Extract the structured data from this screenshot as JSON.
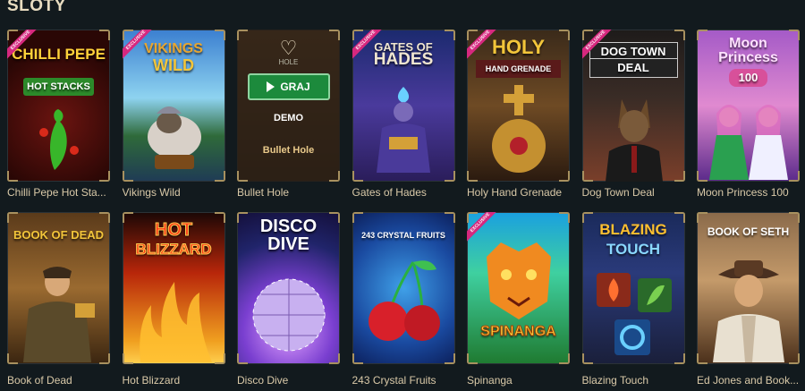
{
  "section": {
    "title": "SLOTY"
  },
  "badge": {
    "exclusive": "EXCLUSIVE"
  },
  "hover": {
    "play_label": "GRAJ",
    "demo_label": "DEMO",
    "art_label": "HOLE"
  },
  "games": [
    {
      "name": "Chilli Pepe Hot Sta...",
      "art_title": "CHILLI PEPE",
      "art_sub": "HOT STACKS",
      "exclusive": true
    },
    {
      "name": "Vikings Wild",
      "art_title": "VIKINGS",
      "art_sub": "WILD",
      "exclusive": true
    },
    {
      "name": "Bullet Hole",
      "art_title": "",
      "art_sub": "",
      "exclusive": false
    },
    {
      "name": "Gates of Hades",
      "art_title": "GATES OF",
      "art_sub": "HADES",
      "exclusive": true
    },
    {
      "name": "Holy Hand Grenade",
      "art_title": "HOLY",
      "art_sub": "HAND GRENADE",
      "exclusive": true
    },
    {
      "name": "Dog Town Deal",
      "art_title": "DOG TOWN",
      "art_sub": "DEAL",
      "exclusive": true
    },
    {
      "name": "Moon Princess 100",
      "art_title": "Moon Princess",
      "art_sub": "100",
      "exclusive": false
    },
    {
      "name": "Book of Dead",
      "art_title": "BOOK OF DEAD",
      "art_sub": "",
      "exclusive": false
    },
    {
      "name": "Hot Blizzard",
      "art_title": "HOT",
      "art_sub": "BLIZZARD",
      "exclusive": false
    },
    {
      "name": "Disco Dive",
      "art_title": "DISCO",
      "art_sub": "DIVE",
      "exclusive": false
    },
    {
      "name": "243 Crystal Fruits",
      "art_title": "243 CRYSTAL FRUITS",
      "art_sub": "",
      "exclusive": false
    },
    {
      "name": "Spinanga",
      "art_title": "SPINANGA",
      "art_sub": "",
      "exclusive": true
    },
    {
      "name": "Blazing Touch",
      "art_title": "BLAZING",
      "art_sub": "TOUCH",
      "exclusive": false
    },
    {
      "name": "Ed Jones and Book...",
      "art_title": "BOOK OF SETH",
      "art_sub": "",
      "exclusive": false
    }
  ],
  "colors": {
    "background": "#121a1e",
    "caption": "#d9c9a8",
    "play_button": "#1c8a3c",
    "exclusive_ribbon": "#d6287e"
  }
}
